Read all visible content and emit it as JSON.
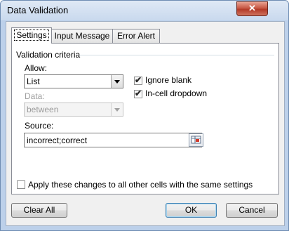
{
  "window": {
    "title": "Data Validation",
    "close_glyph": "✕"
  },
  "tabs": [
    {
      "label": "Settings",
      "active": true
    },
    {
      "label": "Input Message",
      "active": false
    },
    {
      "label": "Error Alert",
      "active": false
    }
  ],
  "criteria": {
    "group_label": "Validation criteria",
    "allow_label": "Allow:",
    "allow_value": "List",
    "data_label": "Data:",
    "data_value": "between",
    "ignore_blank_label": "Ignore blank",
    "ignore_blank_checked": true,
    "dropdown_label": "In-cell dropdown",
    "dropdown_checked": true,
    "source_label": "Source:",
    "source_value": "incorrect;correct"
  },
  "apply_all": {
    "label": "Apply these changes to all other cells with the same settings",
    "checked": false
  },
  "buttons": {
    "clear_all": "Clear All",
    "ok": "OK",
    "cancel": "Cancel"
  },
  "colors": {
    "title_bar": "#c9d9ee",
    "close_button": "#c75845",
    "default_button_border": "#3c7fb1"
  }
}
